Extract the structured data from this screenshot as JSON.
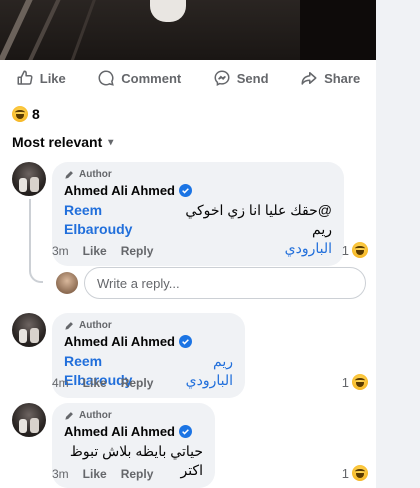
{
  "post_actions": {
    "like": "Like",
    "comment": "Comment",
    "send": "Send",
    "share": "Share"
  },
  "reactions": {
    "emoji": "haha",
    "count": "8"
  },
  "sort": {
    "label": "Most relevant"
  },
  "comments": [
    {
      "author_tag": "Author",
      "name": "Ahmed Ali Ahmed",
      "text_line1": "@حقك عليا انا زي اخوكي ريم",
      "mention": "Reem Elbaroudy",
      "text_line2": "البارودي",
      "time": "3m",
      "like": "Like",
      "reply": "Reply",
      "reaction_count": "1"
    },
    {
      "author_tag": "Author",
      "name": "Ahmed Ali Ahmed",
      "mention": "Reem Elbaroudy",
      "text_line1": "ريم البارودي",
      "time": "4m",
      "like": "Like",
      "reply": "Reply",
      "reaction_count": "1"
    },
    {
      "author_tag": "Author",
      "name": "Ahmed Ali Ahmed",
      "text_line1": "حياتي بايظه بلاش تبوظ اكتر",
      "time": "3m",
      "like": "Like",
      "reply": "Reply",
      "reaction_count": "1"
    }
  ],
  "reply_box": {
    "placeholder": "Write a reply..."
  },
  "colors": {
    "mention": "#216fdb",
    "verified": "#1b74e4",
    "bubble": "#f0f2f5",
    "muted": "#65676b"
  }
}
